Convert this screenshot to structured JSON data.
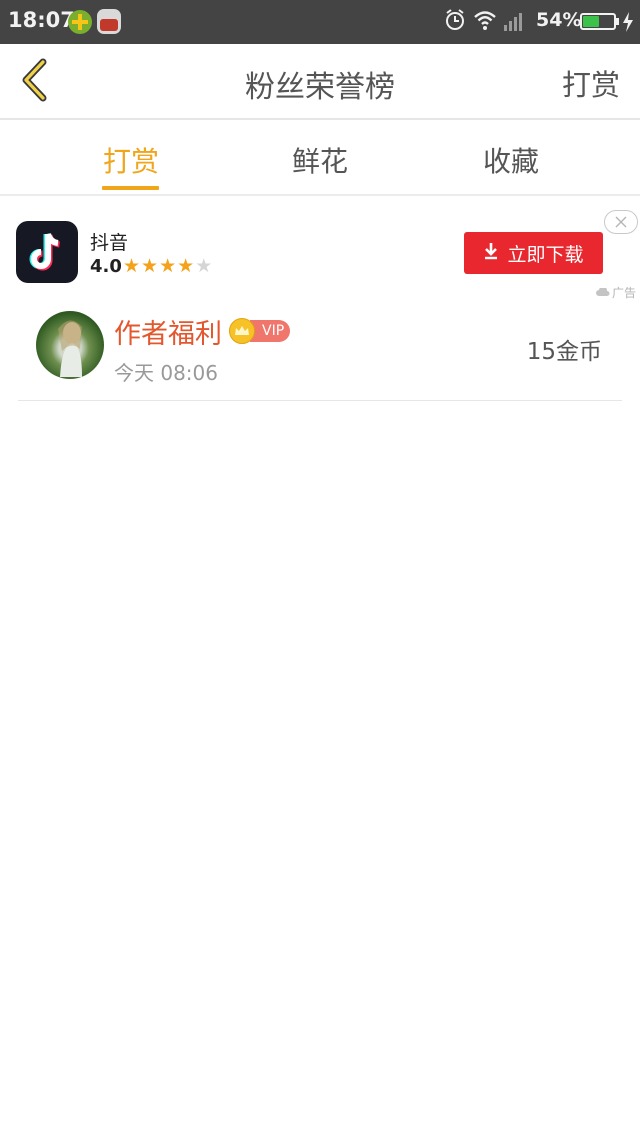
{
  "status_bar": {
    "time": "18:07",
    "battery_percent": "54%",
    "battery_level": 0.54,
    "icons": [
      "app-plus-icon",
      "app-bag-icon",
      "alarm-icon",
      "wifi-icon",
      "signal-icon",
      "battery-icon",
      "charging-bolt-icon"
    ]
  },
  "header": {
    "title": "粉丝荣誉榜",
    "action_label": "打赏",
    "back_icon": "chevron-left-icon"
  },
  "tabs": {
    "items": [
      {
        "label": "打赏",
        "active": true
      },
      {
        "label": "鲜花",
        "active": false
      },
      {
        "label": "收藏",
        "active": false
      }
    ],
    "active_color": "#f0a51a"
  },
  "ad": {
    "app_name": "抖音",
    "rating": "4.0",
    "stars_filled": 4,
    "stars_total": 5,
    "download_label": "立即下载",
    "ad_label": "广告",
    "button_color": "#e8272e"
  },
  "list": {
    "rows": [
      {
        "name": "作者福利",
        "badge": "VIP",
        "time": "今天 08:06",
        "amount": "15金币",
        "name_color": "#e4572e"
      }
    ]
  }
}
